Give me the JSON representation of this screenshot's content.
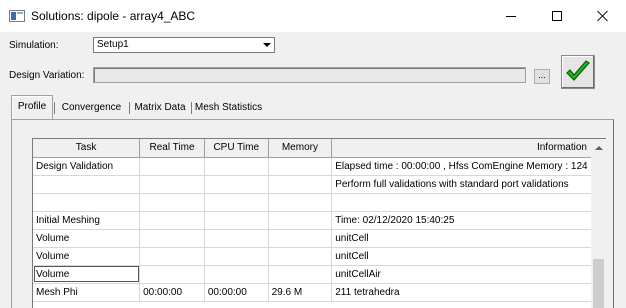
{
  "window": {
    "title": "Solutions: dipole - array4_ABC"
  },
  "simulation": {
    "label": "Simulation:",
    "value": "Setup1"
  },
  "design_variation": {
    "label": "Design Variation:",
    "value": "",
    "browse_label": "..."
  },
  "tabs": [
    {
      "label": "Profile"
    },
    {
      "label": "Convergence"
    },
    {
      "label": "Matrix Data"
    },
    {
      "label": "Mesh Statistics"
    }
  ],
  "profile_table": {
    "columns": [
      "Task",
      "Real Time",
      "CPU Time",
      "Memory",
      "Information"
    ],
    "rows": [
      [
        "Design Validation",
        "",
        "",
        "",
        "Elapsed time : 00:00:00 , Hfss ComEngine Memory : 124"
      ],
      [
        "",
        "",
        "",
        "",
        "Perform full validations with standard port validations"
      ],
      [
        "",
        "",
        "",
        "",
        ""
      ],
      [
        "Initial Meshing",
        "",
        "",
        "",
        "Time: 02/12/2020 15:40:25"
      ],
      [
        "Volume",
        "",
        "",
        "",
        "unitCell"
      ],
      [
        "Volume",
        "",
        "",
        "",
        "unitCell"
      ],
      [
        "Volume",
        "",
        "",
        "",
        "unitCellAir"
      ],
      [
        "Mesh Phi",
        "00:00:00",
        "00:00:00",
        "29.6 M",
        "211 tetrahedra"
      ]
    ]
  },
  "colors": {
    "check_green": "#1fb51f",
    "check_outline": "#0a5a0a"
  }
}
